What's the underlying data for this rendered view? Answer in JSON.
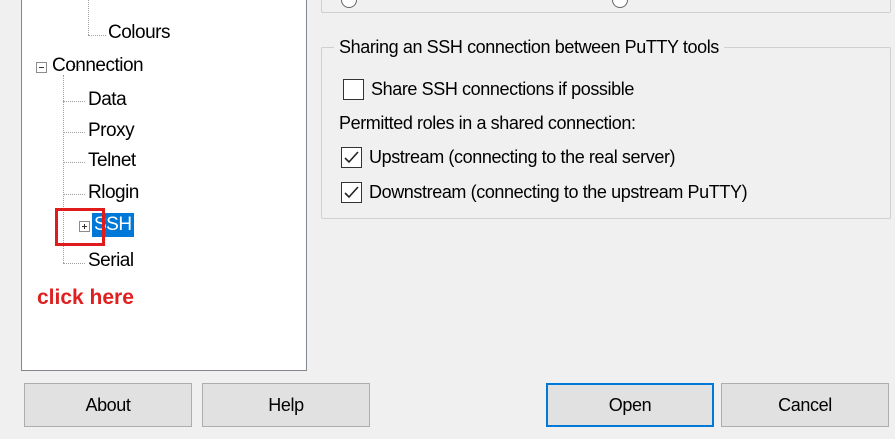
{
  "tree": {
    "items": [
      {
        "label": "Colours"
      },
      {
        "label": "Connection"
      },
      {
        "label": "Data"
      },
      {
        "label": "Proxy"
      },
      {
        "label": "Telnet"
      },
      {
        "label": "Rlogin"
      },
      {
        "label": "SSH"
      },
      {
        "label": "Serial"
      }
    ],
    "selected": "SSH"
  },
  "annotation": {
    "text": "click here",
    "color": "#e02020"
  },
  "sharing": {
    "title": "Sharing an SSH connection between PuTTY tools",
    "share_label": "Share SSH connections if possible",
    "share_checked": false,
    "roles_label": "Permitted roles in a shared connection:",
    "upstream_label": "Upstream (connecting to the real server)",
    "upstream_checked": true,
    "downstream_label": "Downstream (connecting to the upstream PuTTY)",
    "downstream_checked": true
  },
  "buttons": {
    "about": "About",
    "help": "Help",
    "open": "Open",
    "cancel": "Cancel"
  },
  "colors": {
    "selection": "#0078d7",
    "default_button_border": "#0078d7"
  }
}
